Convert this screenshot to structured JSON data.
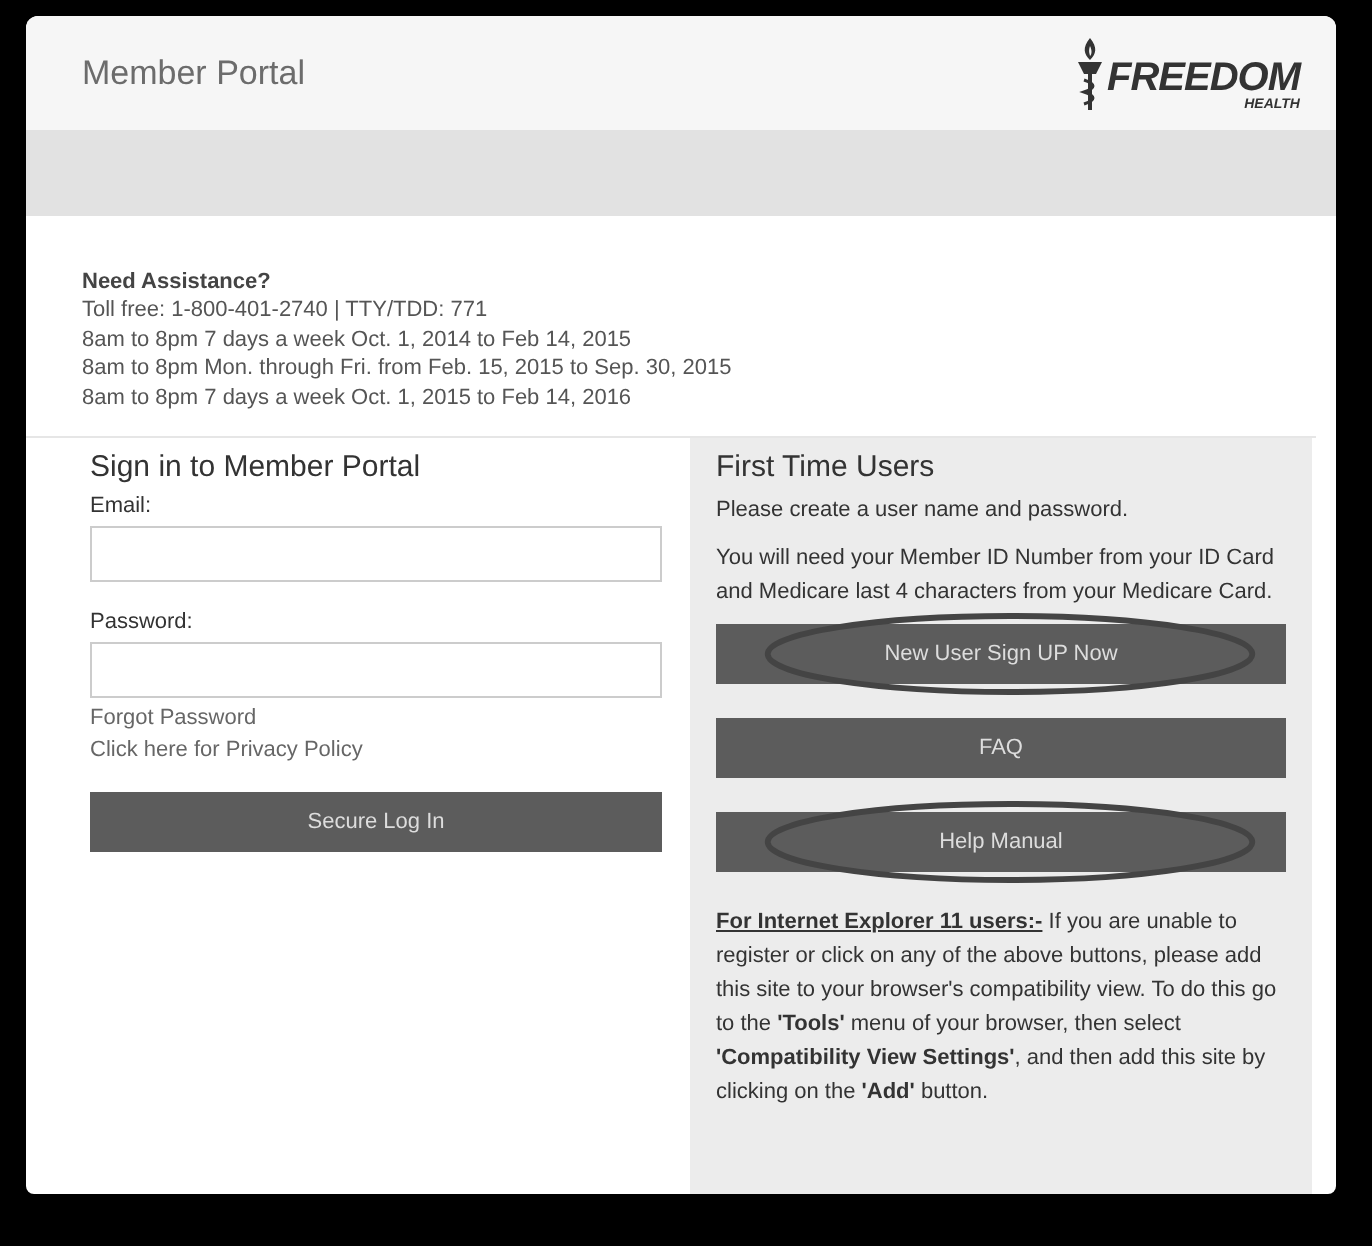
{
  "header": {
    "title": "Member Portal",
    "logo": {
      "name": "FREEDOM",
      "subtitle": "HEALTH"
    }
  },
  "assistance": {
    "heading": "Need Assistance?",
    "lines": [
      "Toll free: 1-800-401-2740 | TTY/TDD: 771",
      "8am to 8pm 7 days a week Oct. 1, 2014 to Feb 14, 2015",
      "8am to 8pm Mon. through Fri. from Feb. 15, 2015 to Sep. 30, 2015",
      "8am to 8pm 7 days a week Oct. 1, 2015 to Feb 14, 2016"
    ]
  },
  "sign_in": {
    "heading": "Sign in to Member Portal",
    "fields": [
      {
        "label": "Email:"
      },
      {
        "label": "Password:"
      }
    ],
    "links": [
      "Forgot Password",
      "Click here for Privacy Policy"
    ],
    "button": "Secure Log In"
  },
  "first_time": {
    "heading": "First Time Users",
    "intro": "Please create a user name and password.",
    "details": "You will need your Member ID Number from your ID Card and Medicare last 4 characters from your Medicare Card.",
    "buttons": [
      {
        "label": "New User Sign UP Now",
        "circled": true
      },
      {
        "label": "FAQ",
        "circled": false
      },
      {
        "label": "Help Manual",
        "circled": true
      }
    ],
    "ie_note": {
      "link": "For Internet Explorer 11 users:-",
      "text": " If you are unable to register or click on any of the above buttons, please add this site to your browser's compatibility view. To do this go to the **'Tools'** menu of your browser, then select **'Compatibility View Settings'**, and then add this site by clicking on the **'Add'** button."
    }
  }
}
